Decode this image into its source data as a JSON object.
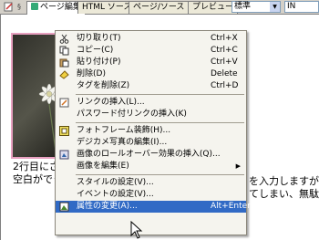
{
  "tabs": {
    "flag": "§",
    "items": [
      {
        "label": "ページ編集"
      },
      {
        "label": "HTML ソース"
      },
      {
        "label": "ページ/ソース"
      },
      {
        "label": "プレビュー"
      }
    ],
    "style_combo": "標準",
    "size_combo": "IN"
  },
  "document": {
    "line1": "2行目にさ",
    "line2": "空白ができ",
    "line1_right": "を入力しますが、",
    "line2_right": "てしまい、無駄な"
  },
  "context_menu": {
    "items": [
      {
        "label": "切り取り(T)",
        "shortcut": "Ctrl+X",
        "icon": "scissors-icon"
      },
      {
        "label": "コピー(C)",
        "shortcut": "Ctrl+C",
        "icon": "copy-icon"
      },
      {
        "label": "貼り付け(P)",
        "shortcut": "Ctrl+V",
        "icon": "paste-icon"
      },
      {
        "label": "削除(D)",
        "shortcut": "Delete",
        "icon": "eraser-icon"
      },
      {
        "label": "タグを削除(Z)",
        "shortcut": "Ctrl+D",
        "icon": ""
      },
      {
        "label": "リンクの挿入(L)...",
        "shortcut": "",
        "icon": "link-icon"
      },
      {
        "label": "パスワード付リンクの挿入(K)",
        "shortcut": "",
        "icon": ""
      },
      {
        "label": "フォトフレーム装飾(H)...",
        "shortcut": "",
        "icon": "frame-icon"
      },
      {
        "label": "デジカメ写真の編集(I)...",
        "shortcut": "",
        "icon": ""
      },
      {
        "label": "画像のロールオーバー効果の挿入(Q)...",
        "shortcut": "",
        "icon": "rollover-icon"
      },
      {
        "label": "画像を編集(E)",
        "shortcut": "",
        "icon": ""
      },
      {
        "label": "スタイルの設定(V)...",
        "shortcut": "",
        "icon": ""
      },
      {
        "label": "イベントの設定(V)...",
        "shortcut": "",
        "icon": ""
      },
      {
        "label": "属性の変更(A)...",
        "shortcut": "Alt+Enter",
        "icon": "properties-icon"
      }
    ]
  },
  "colors": {
    "highlight": "#316ac5",
    "menu_bg": "#f5f4ee",
    "photo_frame": "#e8a0c0"
  }
}
